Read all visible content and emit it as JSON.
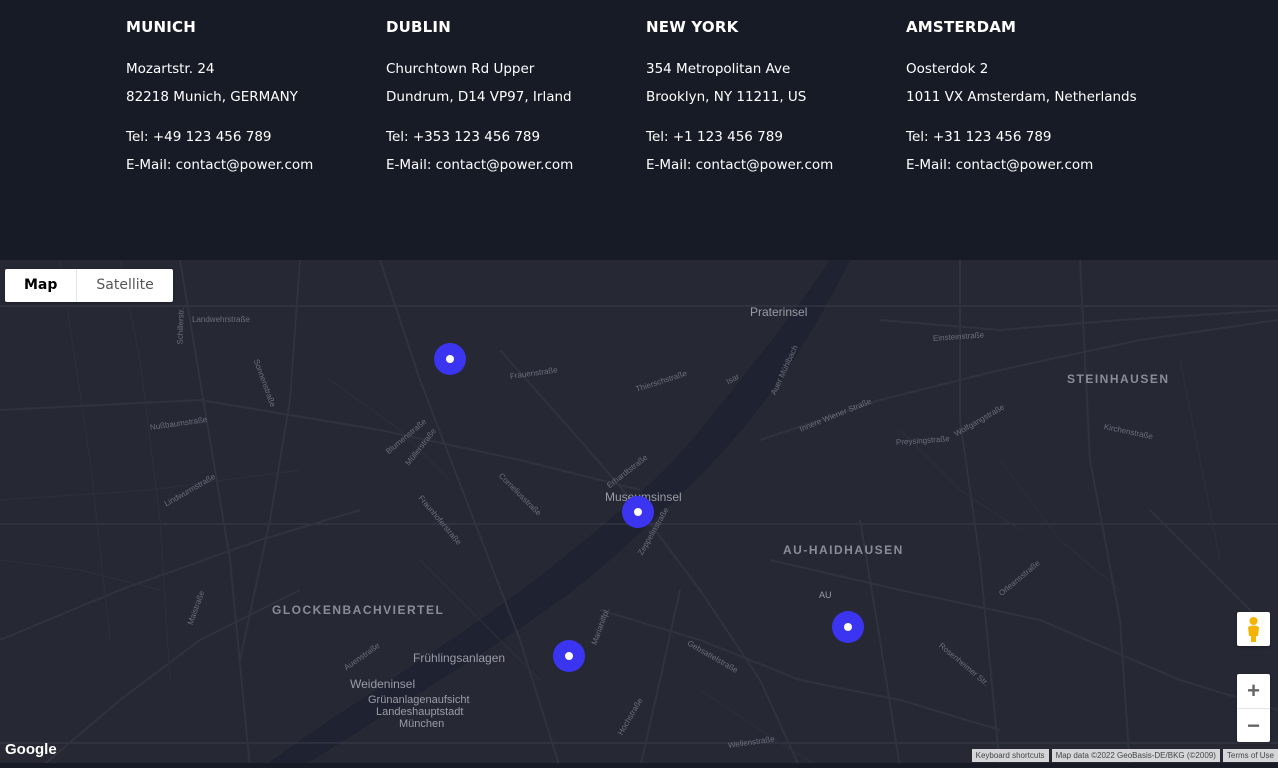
{
  "offices": [
    {
      "city": "MUNICH",
      "street": "Mozartstr. 24",
      "postal": "82218 Munich, GERMANY",
      "tel": "Tel: +49 123 456 789",
      "email": "E-Mail: contact@power.com"
    },
    {
      "city": "DUBLIN",
      "street": "Churchtown Rd Upper",
      "postal": "Dundrum, D14 VP97, Irland",
      "tel": "Tel: +353 123 456 789",
      "email": "E-Mail: contact@power.com"
    },
    {
      "city": "NEW YORK",
      "street": "354 Metropolitan Ave",
      "postal": "Brooklyn, NY 11211, US",
      "tel": "Tel: +1 123 456 789",
      "email": "E-Mail: contact@power.com"
    },
    {
      "city": "AMSTERDAM",
      "street": "Oosterdok 2",
      "postal": "1011 VX Amsterdam, Netherlands",
      "tel": "Tel: +31 123 456 789",
      "email": "E-Mail: contact@power.com"
    }
  ],
  "map": {
    "type_buttons": {
      "map": "Map",
      "satellite": "Satellite"
    },
    "active_type": "Map",
    "districts": [
      "STEINHAUSEN",
      "AU-HAIDHAUSEN",
      "GLOCKENBACHVIERTEL"
    ],
    "places": [
      "Praterinsel",
      "Museumsinsel",
      "Frühlingsanlagen",
      "Weideninsel",
      "Grünanlagenaufsicht",
      "Landeshauptstadt",
      "München",
      "AU"
    ],
    "streets": [
      "Landwehrstraße",
      "Schillerstr.",
      "Sonnenstraße",
      "Frauenstraße",
      "Thierschstraße",
      "Einsteinstraße",
      "Innere Wiener Straße",
      "Nußbaumstraße",
      "Blumenstraße",
      "Müllerstraße",
      "Erhardtstraße",
      "Lindwurmstraße",
      "Fraunhoferstraße",
      "Zeppelinstraße",
      "Gebsattelstraße",
      "Rosenheimer Str.",
      "Auenstraße",
      "Wolfgangstraße",
      "Kirchenstraße",
      "Preysingstraße",
      "Isar",
      "Mariahilfpl.",
      "Wellenstraße",
      "Orleansstraße",
      "Hochstraße",
      "Maistraße",
      "Corneliusstraße",
      "Auer Mühlbach"
    ],
    "pins": 4,
    "zoom_in": "+",
    "zoom_out": "−",
    "logo": "Google",
    "attribution": {
      "shortcuts": "Keyboard shortcuts",
      "data": "Map data ©2022 GeoBasis-DE/BKG (©2009)",
      "terms": "Terms of Use"
    }
  },
  "colors": {
    "page_bg": "#171b26",
    "map_bg": "#262834",
    "pin": "#3b35f2",
    "text": "#ffffff"
  }
}
